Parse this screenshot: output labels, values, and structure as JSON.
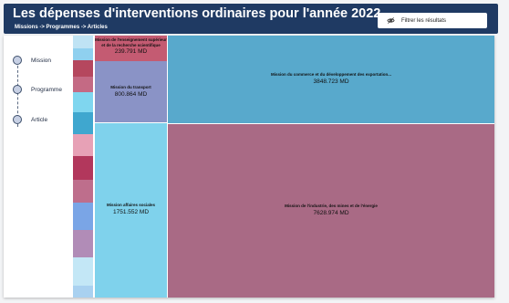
{
  "header": {
    "title": "Les dépenses d'interventions ordinaires pour l'année 2022",
    "breadcrumb": "Missions -> Programmes -> Articles",
    "filter_label": "Filtrer les résultats"
  },
  "levels": [
    {
      "label": "Mission"
    },
    {
      "label": "Programme"
    },
    {
      "label": "Article"
    }
  ],
  "treemap": {
    "tiles": [
      {
        "color": "#bfe3f4"
      },
      {
        "color": "#8fd0ef"
      },
      {
        "color": "#b5475e"
      },
      {
        "color": "#c46a84"
      },
      {
        "color": "#d8a7bd"
      },
      {
        "color": "#7fd6ef"
      },
      {
        "color": "#3fa7cf"
      },
      {
        "color": "#e7a1b6"
      },
      {
        "color": "#b2375c"
      },
      {
        "color": "#be6e8c"
      },
      {
        "color": "#7aa5e6"
      },
      {
        "color": "#b18cb7"
      },
      {
        "color": "#c3e7f6"
      },
      {
        "color": "#a9d1f0"
      }
    ],
    "cells": [
      {
        "name": "Mission de l'enseignement supérieur et de la recherche scientifique",
        "value": "239.791 MD",
        "color": "#c45b72"
      },
      {
        "name": "Mission du transport",
        "value": "800.864 MD",
        "color": "#8a93c6"
      },
      {
        "name": "Mission affaires sociales",
        "value": "1751.552 MD",
        "color": "#7fd2ec"
      },
      {
        "name": "Mission du commerce et du développement des exportation...",
        "value": "3848.723 MD",
        "color": "#58a9cc"
      },
      {
        "name": "Mission de l'industrie, des mines et de l'énergie",
        "value": "7628.974 MD",
        "color": "#a96a85"
      }
    ]
  }
}
